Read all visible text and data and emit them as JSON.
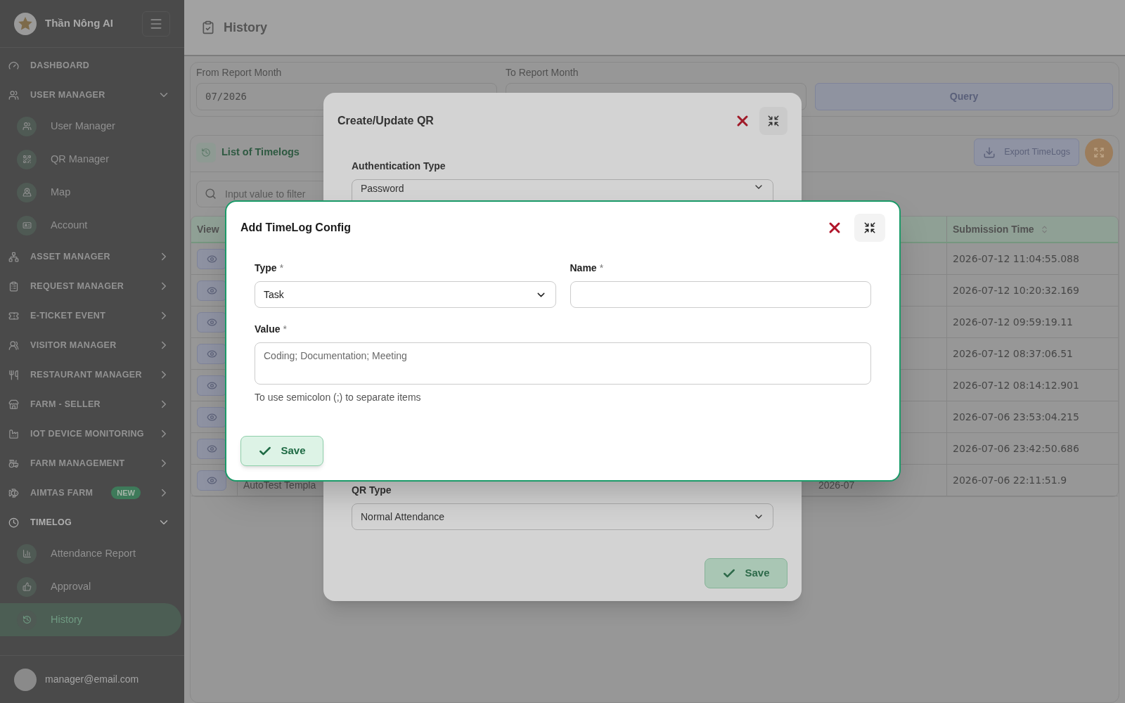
{
  "sidebar": {
    "brand": "Thần Nông AI",
    "items": [
      {
        "label": "DASHBOARD",
        "kind": "link"
      },
      {
        "label": "USER MANAGER",
        "kind": "group",
        "expanded": true,
        "children": [
          {
            "label": "User Manager",
            "selected": false
          },
          {
            "label": "QR Manager",
            "selected": false
          },
          {
            "label": "Map",
            "selected": false
          },
          {
            "label": "Account",
            "selected": false
          }
        ]
      },
      {
        "label": "ASSET MANAGER",
        "kind": "group",
        "expanded": false
      },
      {
        "label": "REQUEST MANAGER",
        "kind": "group",
        "expanded": false
      },
      {
        "label": "E-TICKET EVENT",
        "kind": "group",
        "expanded": false
      },
      {
        "label": "VISITOR MANAGER",
        "kind": "group",
        "expanded": false
      },
      {
        "label": "RESTAURANT MANAGER",
        "kind": "group",
        "expanded": false
      },
      {
        "label": "FARM - SELLER",
        "kind": "group",
        "expanded": false
      },
      {
        "label": "IOT DEVICE MONITORING",
        "kind": "group",
        "expanded": false
      },
      {
        "label": "FARM MANAGEMENT",
        "kind": "group",
        "expanded": false
      },
      {
        "label": "AIMTAS FARM",
        "kind": "group",
        "expanded": false,
        "badge": "NEW"
      },
      {
        "label": "TIMELOG",
        "kind": "group",
        "expanded": true,
        "children": [
          {
            "label": "Attendance Report",
            "selected": false
          },
          {
            "label": "Approval",
            "selected": false
          },
          {
            "label": "History",
            "selected": true
          }
        ]
      }
    ],
    "user": "manager@email.com"
  },
  "header": {
    "title": "History"
  },
  "filters": {
    "from_label": "From Report Month",
    "from_value": "07/2026",
    "to_label": "To Report Month",
    "query_button": "Query"
  },
  "list": {
    "title": "List of Timelogs",
    "export_button": "Export TimeLogs",
    "search_placeholder": "Input value to filter"
  },
  "table": {
    "columns": {
      "view": "View",
      "submission_time": "Submission Time"
    },
    "rows": [
      {
        "submission_time": "2026-07-12 11:04:55.088"
      },
      {
        "submission_time": "2026-07-12 10:20:32.169"
      },
      {
        "submission_time": "2026-07-12 09:59:19.11"
      },
      {
        "submission_time": "2026-07-12 08:37:06.51"
      },
      {
        "submission_time": "2026-07-12 08:14:12.901"
      },
      {
        "submission_time": "2026-07-06 23:53:04.215"
      },
      {
        "submission_time": "2026-07-06 23:42:50.686"
      },
      {
        "column_2": "AutoTest Templa",
        "column_3": "2026-07",
        "submission_time": "2026-07-06 22:11:51.9"
      }
    ]
  },
  "qr_dialog": {
    "title": "Create/Update QR",
    "auth_label": "Authentication Type",
    "auth_value": "Password",
    "qr_type_label": "QR Type",
    "qr_type_value": "Normal Attendance",
    "save_button": "Save"
  },
  "timelog_dialog": {
    "title": "Add TimeLog Config",
    "type_label": "Type",
    "type_mark": "*",
    "type_value": "Task",
    "name_label": "Name",
    "name_mark": "*",
    "value_label": "Value",
    "value_mark": "*",
    "value_placeholder": "Coding; Documentation; Meeting",
    "hint": "To use semicolon (;) to separate items",
    "save_button": "Save"
  }
}
